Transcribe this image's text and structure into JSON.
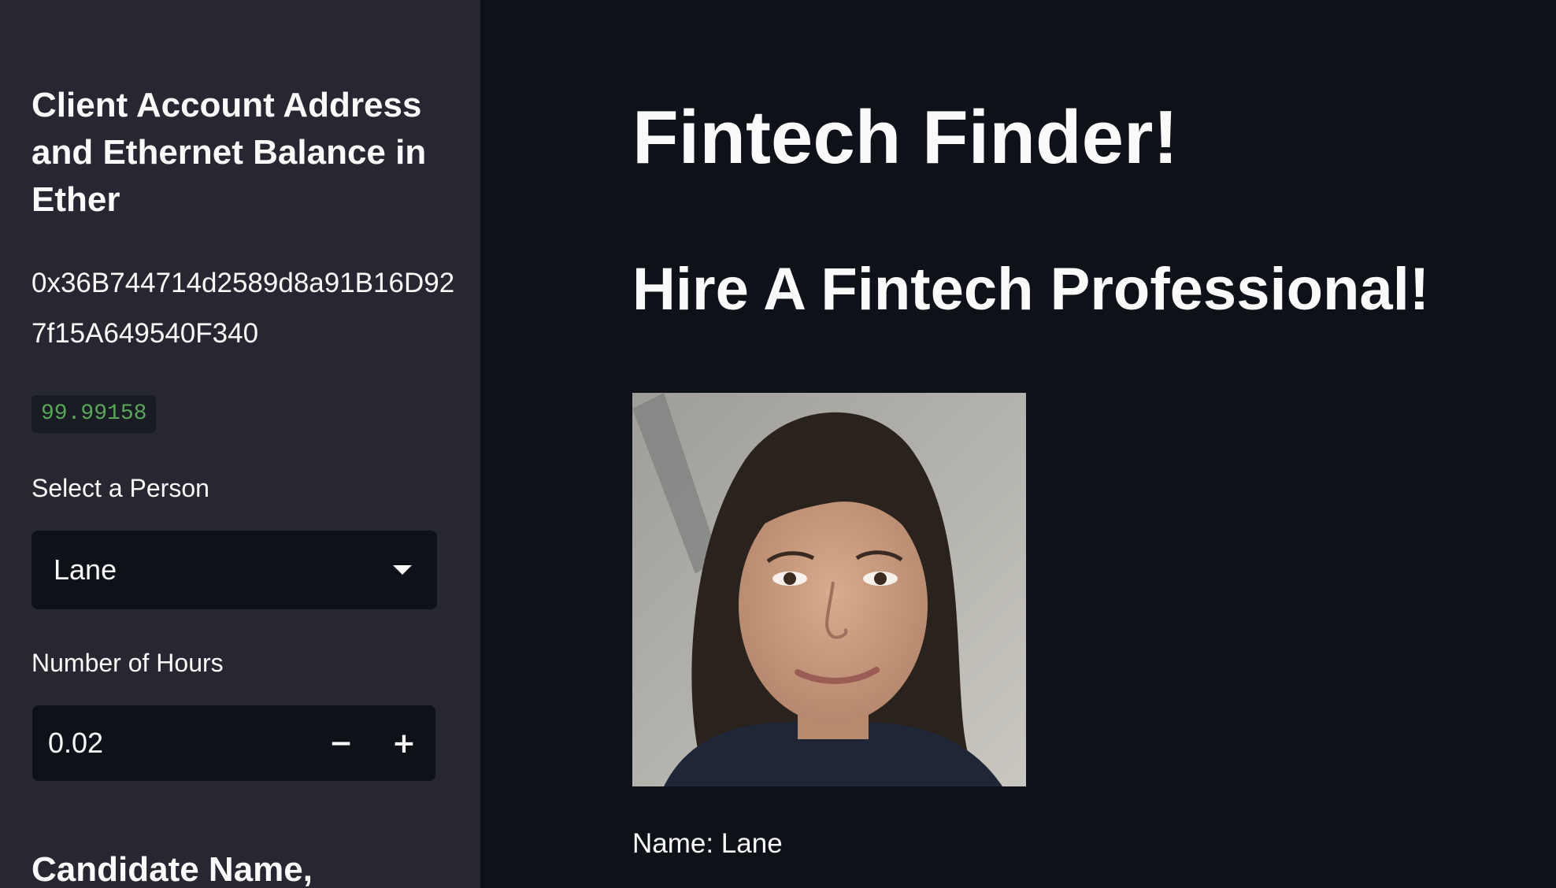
{
  "sidebar": {
    "heading": "Client Account Address and Ethernet Balance in Ether",
    "address": "0x36B744714d2589d8a91B16D927f15A649540F340",
    "balance": "99.99158",
    "select_label": "Select a Person",
    "selected_person": "Lane",
    "hours_label": "Number of Hours",
    "hours_value": "0.02",
    "decrement_label": "−",
    "increment_label": "+",
    "candidate_heading": "Candidate Name,"
  },
  "main": {
    "title": "Fintech Finder!",
    "subtitle": "Hire A Fintech Professional!",
    "name_line": "Name: Lane"
  },
  "colors": {
    "sidebar_bg": "#262730",
    "main_bg": "#0e1117",
    "balance_text": "#5aa65a",
    "text": "#fafafa"
  },
  "icons": {
    "select_caret": "chevron-down-icon"
  }
}
